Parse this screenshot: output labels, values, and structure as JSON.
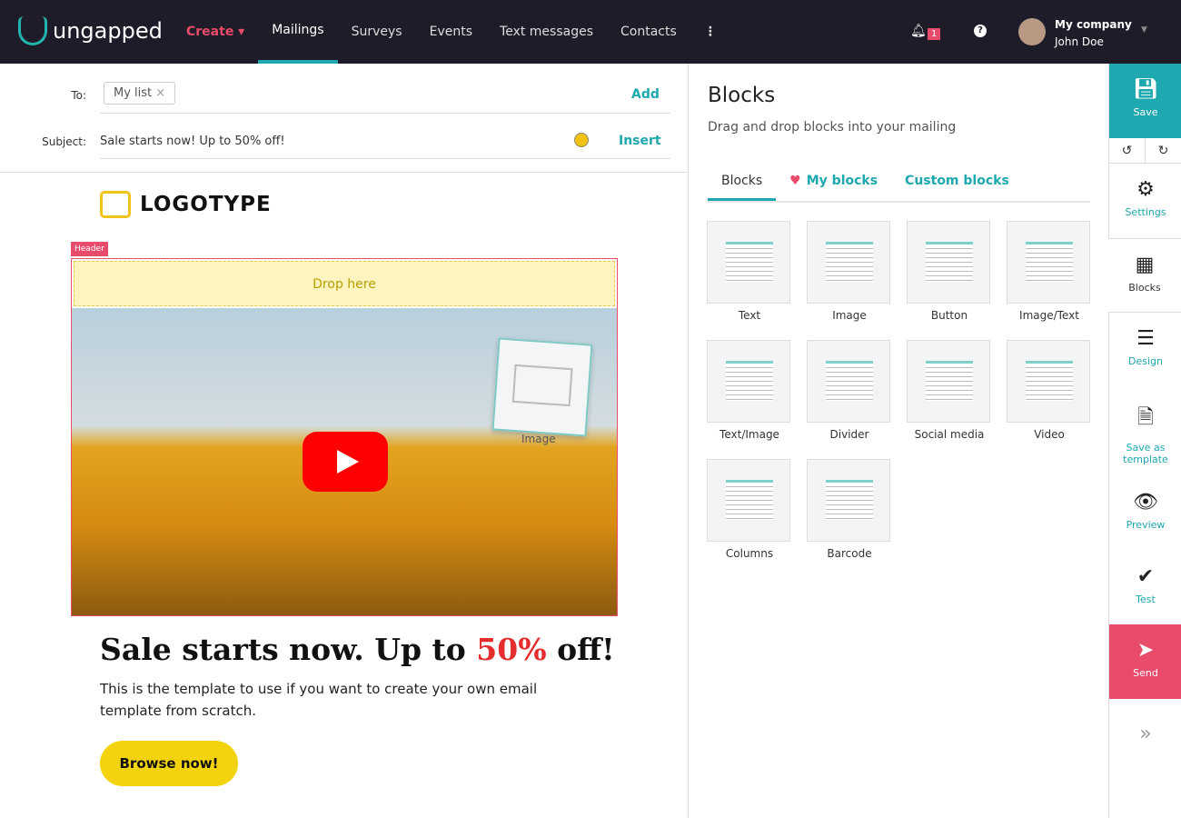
{
  "nav": {
    "brand": "ungapped",
    "items": [
      "Create",
      "Mailings",
      "Surveys",
      "Events",
      "Text messages",
      "Contacts"
    ],
    "more": "⋮",
    "notif_count": "1",
    "company": "My company",
    "user": "John Doe"
  },
  "compose": {
    "to_label": "To:",
    "to_chip": "My list",
    "add": "Add",
    "subject_label": "Subject:",
    "subject": "Sale starts now! Up to 50% off!",
    "insert": "Insert"
  },
  "email": {
    "logotype": "LOGOTYPE",
    "header_tag": "Header",
    "drop_here": "Drop here",
    "drag_label": "Image",
    "headline_a": "Sale starts now. Up to ",
    "headline_b": "50%",
    "headline_c": " off!",
    "body": "This is the template to use if you want to create your own email template from scratch.",
    "cta": "Browse now!"
  },
  "panel": {
    "title": "Blocks",
    "subtitle": "Drag and drop blocks into your mailing",
    "tabs": [
      "Blocks",
      "My blocks",
      "Custom blocks"
    ],
    "blocks": [
      "Text",
      "Image",
      "Button",
      "Image/Text",
      "Text/Image",
      "Divider",
      "Social media",
      "Video",
      "Columns",
      "Barcode"
    ]
  },
  "side": {
    "save": "Save",
    "settings": "Settings",
    "blocks": "Blocks",
    "design": "Design",
    "save_template": "Save as template",
    "preview": "Preview",
    "test": "Test",
    "send": "Send"
  },
  "colors": {
    "accent": "#1ea8b0",
    "brand_pink": "#e94b6a",
    "nav_bg": "#1f1c29",
    "cta": "#f2d30d"
  }
}
